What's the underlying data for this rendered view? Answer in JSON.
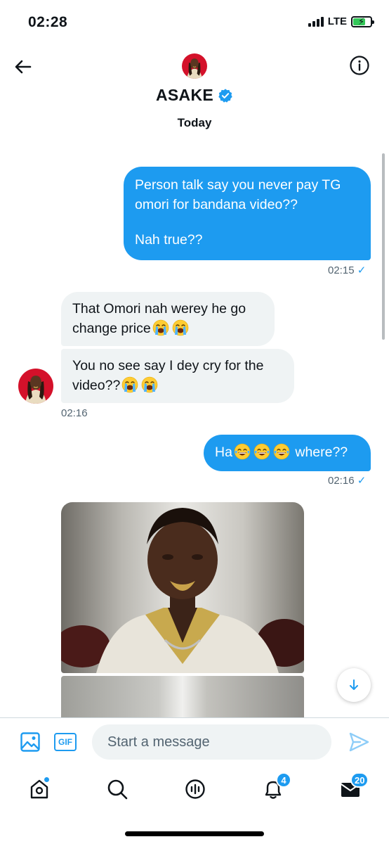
{
  "status_bar": {
    "time": "02:28",
    "network": "LTE",
    "battery_charging": true,
    "battery_level": 0.7
  },
  "header": {
    "name": "ASAKE",
    "verified": true,
    "date_label": "Today"
  },
  "messages": {
    "out1": {
      "line1": "Person talk say you never pay TG",
      "line2": "omori for bandana video??",
      "line3": "Nah true??",
      "time": "02:15",
      "check": "✓"
    },
    "in1": {
      "line1": "That Omori nah werey he go",
      "line2": "change price"
    },
    "in2": {
      "line1": "You no see say I dey cry for the",
      "line2": "video??",
      "time": "02:16"
    },
    "out2": {
      "text_start": "Ha",
      "text_end": " where??",
      "time": "02:16",
      "check": "✓"
    }
  },
  "composer": {
    "placeholder": "Start a message",
    "gif_label": "GIF"
  },
  "nav": {
    "notifications_badge": "4",
    "messages_badge": "20"
  },
  "colors": {
    "accent": "#1d9bf0",
    "incoming_bubble": "#eff3f4",
    "text_secondary": "#536471"
  }
}
